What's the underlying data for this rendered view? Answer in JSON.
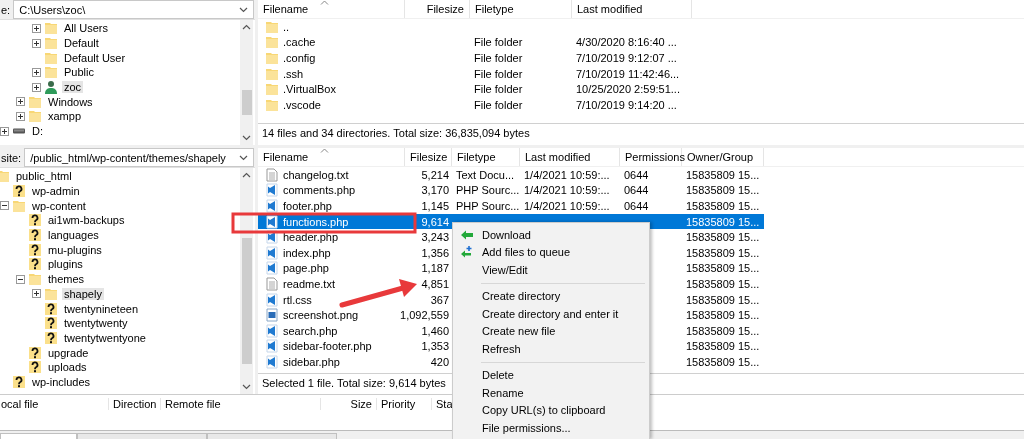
{
  "local_site": {
    "label": "e:",
    "path": "C:\\Users\\zoc\\"
  },
  "local_tree": [
    {
      "children": [
        {
          "children": [
            {
              "label": "All Users",
              "kind": "folder",
              "expanded": false,
              "selected": false
            },
            {
              "label": "Default",
              "kind": "folder",
              "expanded": false,
              "selected": false
            },
            {
              "label": "Default User",
              "kind": "folder",
              "selected": false
            },
            {
              "label": "Public",
              "kind": "folder",
              "expanded": false,
              "selected": false
            },
            {
              "label": "zoc",
              "kind": "user",
              "expanded": false,
              "selected": true
            }
          ]
        },
        {
          "label": "Windows",
          "kind": "folder",
          "expanded": false,
          "selected": false
        },
        {
          "label": "xampp",
          "kind": "folder",
          "expanded": false,
          "selected": false
        }
      ]
    },
    {
      "label": "D:",
      "kind": "drive",
      "expanded": false,
      "selected": false
    }
  ],
  "local_files": {
    "columns": [
      "Filename",
      "Filesize",
      "Filetype",
      "Last modified"
    ],
    "rows": [
      {
        "kind": "folder",
        "filename": "..",
        "selected": false
      },
      {
        "kind": "folder",
        "filename": ".cache",
        "filetype": "File folder",
        "last_modified": "4/30/2020 8:16:40 ...",
        "selected": false
      },
      {
        "kind": "folder",
        "filename": ".config",
        "filetype": "File folder",
        "last_modified": "7/10/2019 9:12:07 ...",
        "selected": false
      },
      {
        "kind": "folder",
        "filename": ".ssh",
        "filetype": "File folder",
        "last_modified": "7/10/2019 11:42:46...",
        "selected": false
      },
      {
        "kind": "folder",
        "filename": ".VirtualBox",
        "filetype": "File folder",
        "last_modified": "10/25/2020 2:59:51...",
        "selected": false
      },
      {
        "kind": "folder",
        "filename": ".vscode",
        "filetype": "File folder",
        "last_modified": "7/10/2019 9:14:20 ...",
        "selected": false
      }
    ],
    "status": "14 files and 34 directories. Total size: 36,835,094 bytes"
  },
  "remote_site": {
    "label": "site:",
    "path": "/public_html/wp-content/themes/shapely"
  },
  "remote_tree": [
    {
      "label": "public_html",
      "kind": "folder",
      "selected": false,
      "children": [
        {
          "label": "wp-admin",
          "kind": "unknown",
          "selected": false
        },
        {
          "label": "wp-content",
          "kind": "folder",
          "expanded": true,
          "selected": false,
          "children": [
            {
              "label": "ai1wm-backups",
              "kind": "unknown",
              "selected": false
            },
            {
              "label": "languages",
              "kind": "unknown",
              "selected": false
            },
            {
              "label": "mu-plugins",
              "kind": "unknown",
              "selected": false
            },
            {
              "label": "plugins",
              "kind": "unknown",
              "selected": false
            },
            {
              "label": "themes",
              "kind": "folder",
              "expanded": true,
              "selected": false,
              "children": [
                {
                  "label": "shapely",
                  "kind": "folder",
                  "expanded": false,
                  "selected": true
                },
                {
                  "label": "twentynineteen",
                  "kind": "unknown",
                  "selected": false
                },
                {
                  "label": "twentytwenty",
                  "kind": "unknown",
                  "selected": false
                },
                {
                  "label": "twentytwentyone",
                  "kind": "unknown",
                  "selected": false
                }
              ]
            },
            {
              "label": "upgrade",
              "kind": "unknown",
              "selected": false
            },
            {
              "label": "uploads",
              "kind": "unknown",
              "selected": false
            }
          ]
        },
        {
          "label": "wp-includes",
          "kind": "unknown",
          "selected": false
        }
      ]
    }
  ],
  "remote_files": {
    "columns": [
      "Filename",
      "Filesize",
      "Filetype",
      "Last modified",
      "Permissions",
      "Owner/Group"
    ],
    "rows": [
      {
        "kind": "text",
        "filename": "changelog.txt",
        "filesize": "5,214",
        "filetype": "Text Docu...",
        "last_modified": "1/4/2021 10:59:...",
        "permissions": "0644",
        "owner_group": "15835809 15...",
        "selected": false
      },
      {
        "kind": "code",
        "filename": "comments.php",
        "filesize": "3,170",
        "filetype": "PHP Sourc...",
        "last_modified": "1/4/2021 10:59:...",
        "permissions": "0644",
        "owner_group": "15835809 15...",
        "selected": false
      },
      {
        "kind": "code",
        "filename": "footer.php",
        "filesize": "1,145",
        "filetype": "PHP Sourc...",
        "last_modified": "1/4/2021 10:59:...",
        "permissions": "0644",
        "owner_group": "15835809 15...",
        "selected": false
      },
      {
        "kind": "code",
        "filename": "functions.php",
        "filesize": "9,614",
        "owner_group": "15835809 15...",
        "selected": true
      },
      {
        "kind": "code",
        "filename": "header.php",
        "filesize": "3,243",
        "owner_group": "15835809 15...",
        "selected": false
      },
      {
        "kind": "code",
        "filename": "index.php",
        "filesize": "1,356",
        "owner_group": "15835809 15...",
        "selected": false
      },
      {
        "kind": "code",
        "filename": "page.php",
        "filesize": "1,187",
        "owner_group": "15835809 15...",
        "selected": false
      },
      {
        "kind": "text",
        "filename": "readme.txt",
        "filesize": "4,851",
        "owner_group": "15835809 15...",
        "selected": false
      },
      {
        "kind": "code",
        "filename": "rtl.css",
        "filesize": "367",
        "owner_group": "15835809 15...",
        "selected": false
      },
      {
        "kind": "image",
        "filename": "screenshot.png",
        "filesize": "1,092,559",
        "owner_group": "15835809 15...",
        "selected": false
      },
      {
        "kind": "code",
        "filename": "search.php",
        "filesize": "1,460",
        "owner_group": "15835809 15...",
        "selected": false
      },
      {
        "kind": "code",
        "filename": "sidebar-footer.php",
        "filesize": "1,353",
        "owner_group": "15835809 15...",
        "selected": false
      },
      {
        "kind": "code",
        "filename": "sidebar.php",
        "filesize": "420",
        "owner_group": "15835809 15...",
        "selected": false
      }
    ],
    "status": "Selected 1 file. Total size: 9,614 bytes"
  },
  "bottom_tabs": [
    {
      "selected": true
    },
    {
      "selected": false
    },
    {
      "selected": false
    }
  ],
  "queue": {
    "columns": [
      "ocal file",
      "Direction",
      "Remote file",
      "Size",
      "Priority",
      "Sta"
    ]
  },
  "context_menu": {
    "items": [
      {
        "kind": "download",
        "label": "Download"
      },
      {
        "kind": "enqueue",
        "label": "Add files to queue"
      },
      {
        "kind": "plain",
        "label": "View/Edit"
      },
      {
        "kind": "separator"
      },
      {
        "kind": "plain",
        "label": "Create directory"
      },
      {
        "kind": "plain",
        "label": "Create directory and enter it"
      },
      {
        "kind": "plain",
        "label": "Create new file"
      },
      {
        "kind": "plain",
        "label": "Refresh"
      },
      {
        "kind": "separator"
      },
      {
        "kind": "plain",
        "label": "Delete"
      },
      {
        "kind": "plain",
        "label": "Rename"
      },
      {
        "kind": "plain",
        "label": "Copy URL(s) to clipboard"
      },
      {
        "kind": "plain",
        "label": "File permissions..."
      }
    ]
  }
}
